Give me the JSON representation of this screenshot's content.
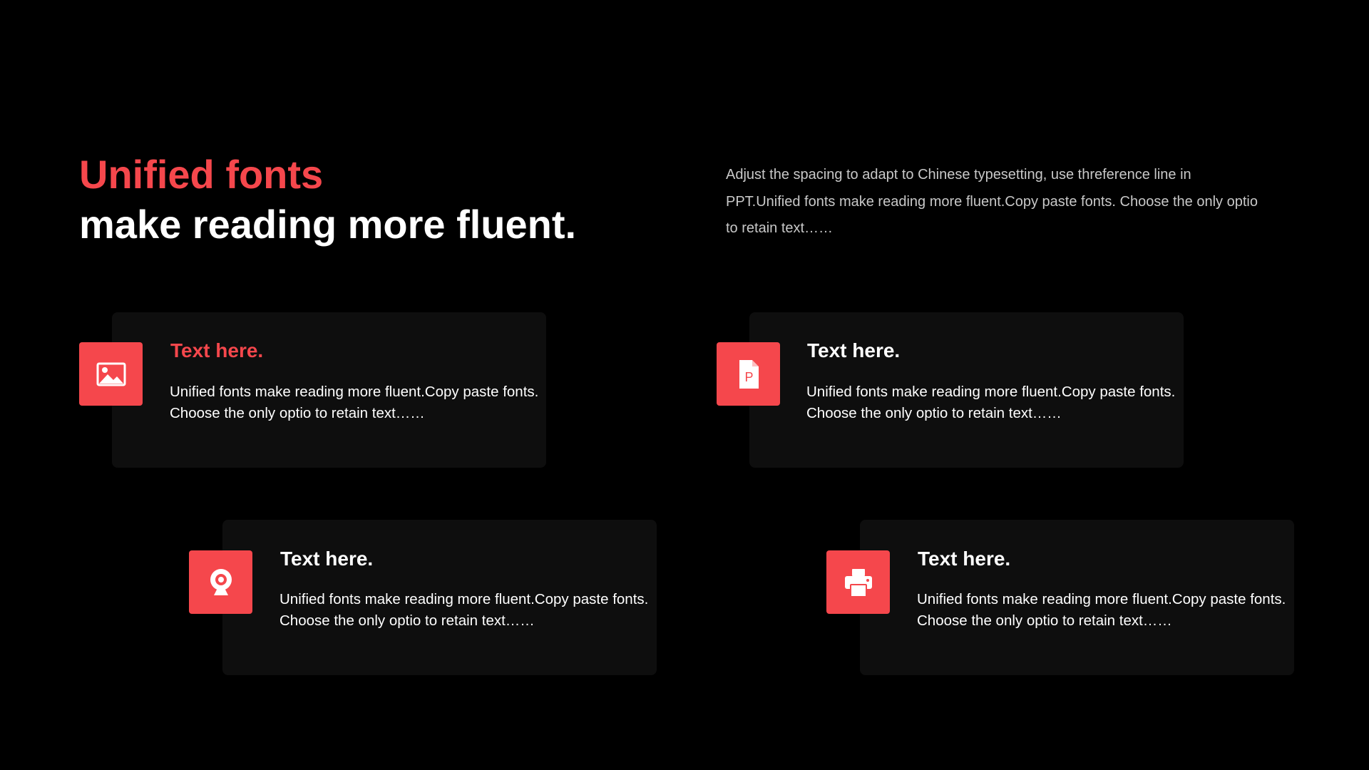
{
  "theme": {
    "accent": "#f5474c",
    "background": "#000000",
    "card_background": "#0e0e0e",
    "text": "#ffffff"
  },
  "headline": {
    "line1": "Unified fonts",
    "line2": "make reading more fluent."
  },
  "intro": "Adjust the spacing to adapt to Chinese typesetting, use threference line in PPT.Unified fonts make reading more fluent.Copy paste fonts. Choose the only optio to retain text……",
  "cards": [
    {
      "icon": "image-icon",
      "title": "Text here.",
      "title_color": "#f5474c",
      "text": "Unified fonts make reading more fluent.Copy paste fonts. Choose the only optio to retain text……"
    },
    {
      "icon": "ppt-file-icon",
      "title": "Text here.",
      "title_color": "#ffffff",
      "text": "Unified fonts make reading more fluent.Copy paste fonts. Choose the only optio to retain text……"
    },
    {
      "icon": "webcam-icon",
      "title": "Text here.",
      "title_color": "#ffffff",
      "text": "Unified fonts make reading more fluent.Copy paste fonts. Choose the only optio to retain text……"
    },
    {
      "icon": "printer-icon",
      "title": "Text here.",
      "title_color": "#ffffff",
      "text": "Unified fonts make reading more fluent.Copy paste fonts. Choose the only optio to retain text……"
    }
  ]
}
